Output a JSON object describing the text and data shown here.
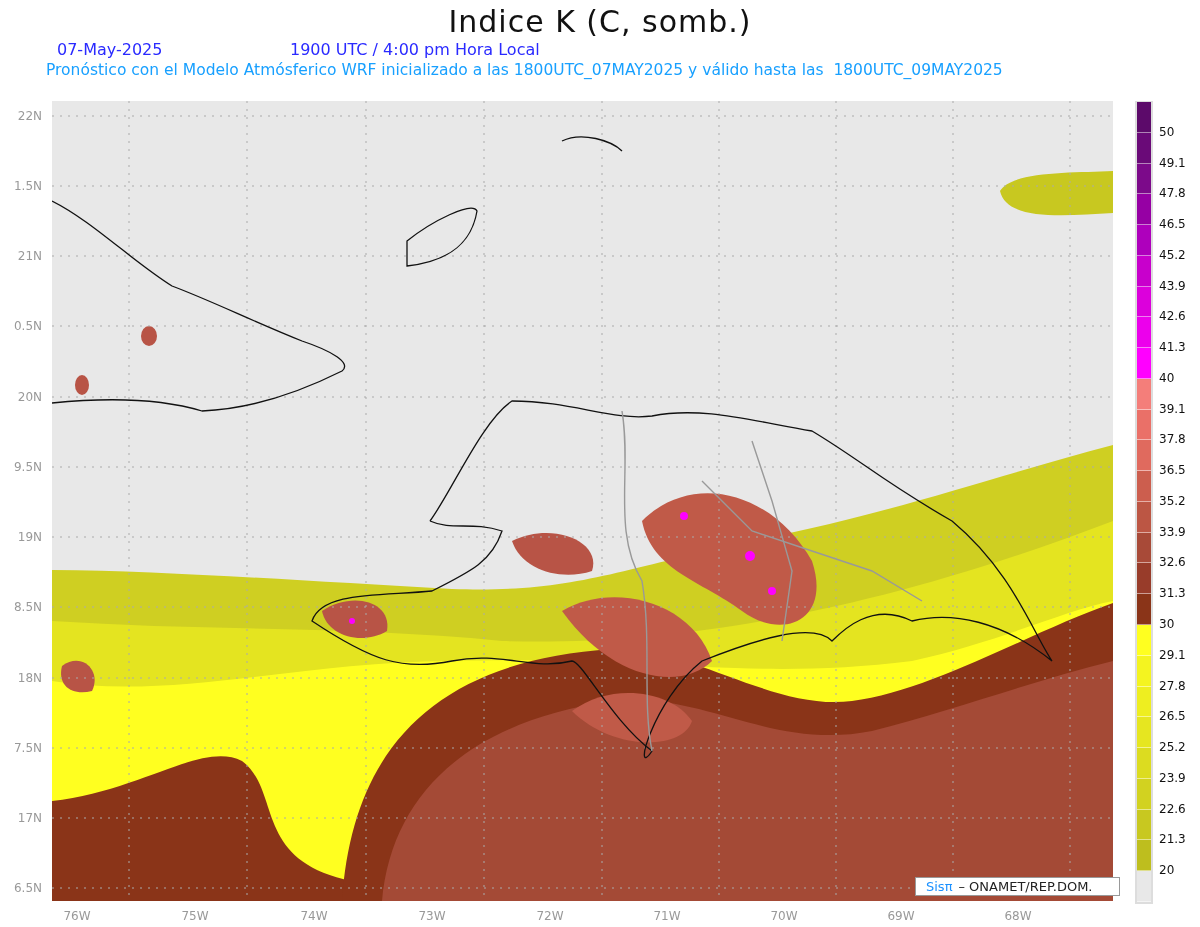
{
  "header": {
    "title": "Indice K (C, somb.)",
    "date": "07-May-2025",
    "time": "1900 UTC / 4:00 pm Hora Local",
    "forecast": "Pronóstico con el Modelo Atmósferico WRF inicializado a las 1800UTC_07MAY2025 y válido hasta las  1800UTC_09MAY2025"
  },
  "y_axis": [
    "22N",
    "1.5N",
    "21N",
    "0.5N",
    "20N",
    "9.5N",
    "19N",
    "8.5N",
    "18N",
    "7.5N",
    "17N",
    "6.5N"
  ],
  "x_axis": [
    "76W",
    "75W",
    "74W",
    "73W",
    "72W",
    "71W",
    "70W",
    "69W",
    "68W"
  ],
  "credit": {
    "brand": "Sisπ",
    "text": "– ONAMET/REP.DOM."
  },
  "legend": {
    "bins": [
      {
        "color": "#5c0a6a",
        "label": "50"
      },
      {
        "color": "#6a0a78",
        "label": "49.1"
      },
      {
        "color": "#7c0a8a",
        "label": "47.8"
      },
      {
        "color": "#9600a4",
        "label": "46.5"
      },
      {
        "color": "#ae00bc",
        "label": "45.2"
      },
      {
        "color": "#c800cc",
        "label": "43.9"
      },
      {
        "color": "#dc00dc",
        "label": "42.6"
      },
      {
        "color": "#ec00ec",
        "label": "41.3"
      },
      {
        "color": "#ff00ff",
        "label": "40"
      },
      {
        "color": "#f47e7a",
        "label": "39.1"
      },
      {
        "color": "#ea7068",
        "label": "37.8"
      },
      {
        "color": "#e06a5e",
        "label": "36.5"
      },
      {
        "color": "#cc5e4e",
        "label": "35.2"
      },
      {
        "color": "#bc5644",
        "label": "33.9"
      },
      {
        "color": "#a84a38",
        "label": "32.6"
      },
      {
        "color": "#983c2a",
        "label": "31.3"
      },
      {
        "color": "#8a3418",
        "label": "30"
      },
      {
        "color": "#ffff20",
        "label": "29.1"
      },
      {
        "color": "#f4f420",
        "label": "27.8"
      },
      {
        "color": "#eeee20",
        "label": "26.5"
      },
      {
        "color": "#e6e620",
        "label": "25.2"
      },
      {
        "color": "#dcdc20",
        "label": "23.9"
      },
      {
        "color": "#d2d220",
        "label": "22.6"
      },
      {
        "color": "#c8c820",
        "label": "21.3"
      },
      {
        "color": "#bebe1e",
        "label": "20"
      },
      {
        "color": "#e8e8e8"
      }
    ]
  }
}
